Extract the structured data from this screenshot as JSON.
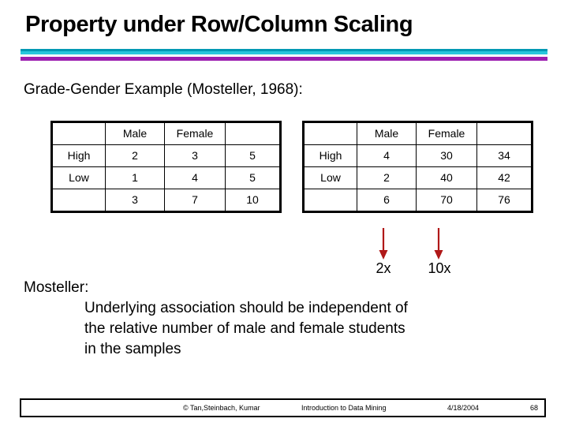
{
  "slide": {
    "title": "Property under Row/Column Scaling",
    "subtitle": "Grade-Gender Example (Mosteller, 1968):"
  },
  "theme": {
    "divider_teal_dark": "#0099B4",
    "divider_teal_light": "#29C6DC",
    "divider_purple": "#9C1FB0",
    "arrow_color": "#B01818"
  },
  "table_left": {
    "name": "original-contingency-table",
    "rows": [
      [
        "",
        "Male",
        "Female",
        ""
      ],
      [
        "High",
        "2",
        "3",
        "5"
      ],
      [
        "Low",
        "1",
        "4",
        "5"
      ],
      [
        "",
        "3",
        "7",
        "10"
      ]
    ]
  },
  "table_right": {
    "name": "scaled-contingency-table",
    "rows": [
      [
        "",
        "Male",
        "Female",
        ""
      ],
      [
        "High",
        "4",
        "30",
        "34"
      ],
      [
        "Low",
        "2",
        "40",
        "42"
      ],
      [
        "",
        "6",
        "70",
        "76"
      ]
    ]
  },
  "annotations": {
    "male_multiplier": "2x",
    "female_multiplier": "10x"
  },
  "body": {
    "lead": "Mosteller:",
    "lines": [
      "Underlying association should be independent of",
      "the relative number of male and female students",
      "in the samples"
    ]
  },
  "footer": {
    "copyright": "© Tan,Steinbach, Kumar",
    "book_title": "Introduction to Data Mining",
    "date": "4/18/2004",
    "page": "68"
  }
}
